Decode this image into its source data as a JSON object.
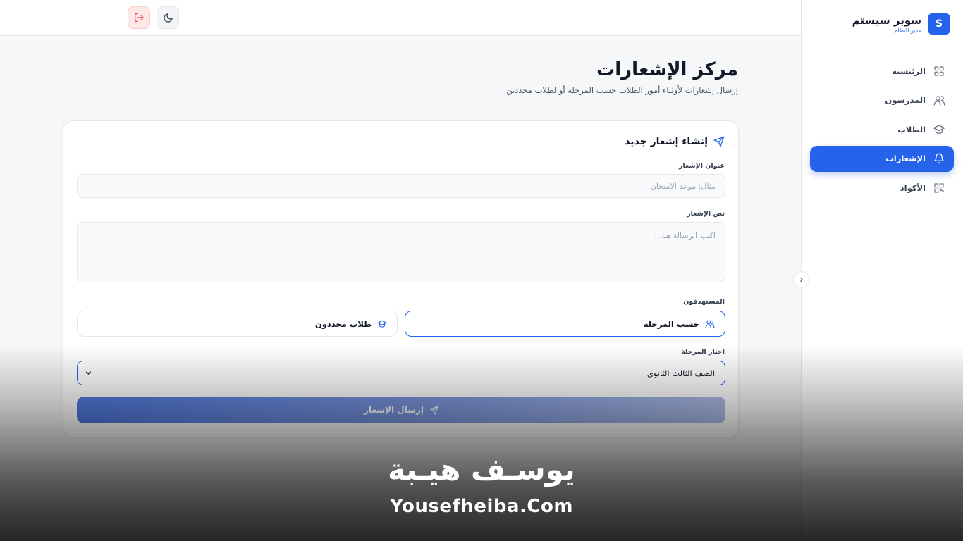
{
  "sidebar": {
    "brand_initial": "S",
    "brand_title": "سوبر سيستم",
    "brand_subtitle": "مدير النظام",
    "items": [
      {
        "label": "الرئيسية",
        "icon": "grid-icon",
        "active": false
      },
      {
        "label": "المدرسون",
        "icon": "users-icon",
        "active": false
      },
      {
        "label": "الطلاب",
        "icon": "graduation-cap-icon",
        "active": false
      },
      {
        "label": "الإشعارات",
        "icon": "bell-icon",
        "active": true
      },
      {
        "label": "الأكواد",
        "icon": "qr-code-icon",
        "active": false
      }
    ]
  },
  "topbar": {
    "theme_icon": "moon-icon",
    "logout_icon": "logout-icon"
  },
  "header": {
    "title": "مركز الإشعارات",
    "subtitle": "إرسال إشعارات لأولياء أمور الطلاب حسب المرحلة أو لطلاب محددين"
  },
  "form": {
    "card_title": "إنشاء إشعار جديد",
    "title_label": "عنوان الإشعار",
    "title_placeholder": "مثال: موعد الامتحان",
    "title_value": "",
    "body_label": "نص الإشعار",
    "body_placeholder": "اكتب الرسالة هنا...",
    "body_value": "",
    "targets_label": "المستهدفون",
    "target_stage": "حسب المرحلة",
    "target_students": "طلاب محددون",
    "target_selected": "حسب المرحلة",
    "stage_label": "اختار المرحلة",
    "stage_selected": "الصف الثالث الثانوي",
    "submit_label": "إرسال الإشعار"
  },
  "watermark": {
    "arabic": "يوسـف هيـبة",
    "english": "Yousefheiba.Com"
  },
  "colors": {
    "accent": "#2563eb",
    "danger": "#ef4444"
  }
}
